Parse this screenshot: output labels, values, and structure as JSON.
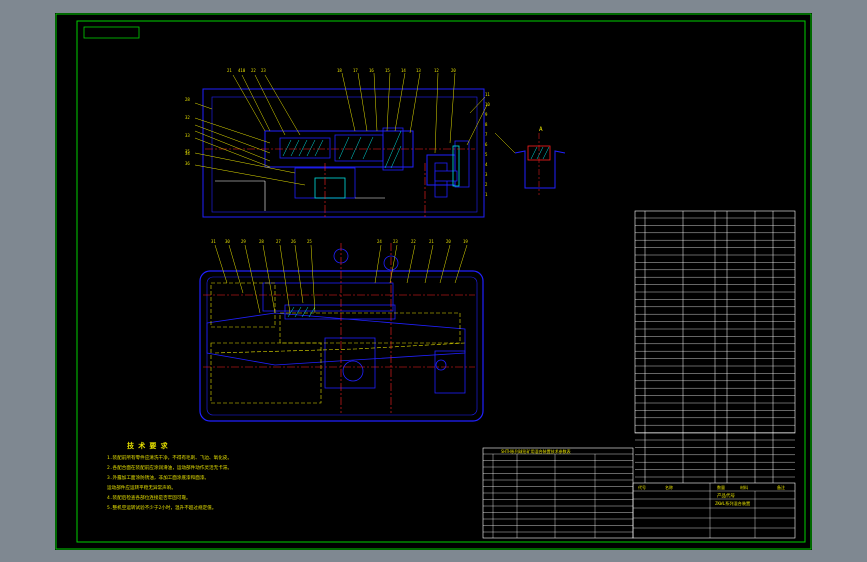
{
  "colors": {
    "background": "#7f8891",
    "sheet": "#000000",
    "frame": "#00d000",
    "outline": "#2020ff",
    "centerline": "#ff2020",
    "callout": "#e6e000",
    "hatch": "#00e0e0",
    "white_line": "#ffffff"
  },
  "top_view_labels": [
    "21",
    "410",
    "22",
    "23",
    "18",
    "17",
    "16",
    "15",
    "14",
    "13",
    "12",
    "20"
  ],
  "left_labels_upper": [
    "28",
    "32",
    "33",
    "34"
  ],
  "left_labels_lower": [
    "35",
    "36"
  ],
  "right_labels": [
    "11",
    "10",
    "9",
    "8",
    "7",
    "6",
    "5",
    "4",
    "3",
    "2",
    "1"
  ],
  "bottom_row_labels": [
    "31",
    "30",
    "29",
    "28",
    "27",
    "26",
    "25",
    "24",
    "23",
    "22",
    "21",
    "20",
    "19"
  ],
  "detail_label": "A",
  "notes": {
    "heading": "技 术 要 求",
    "lines": [
      "1.装配前所有零件应清洗干净，不得有毛刺、飞边、氧化皮。",
      "2.各配合面在装配前应涂润滑油，运动部件动作灵活无卡滞。",
      "3.外露加工面涂防锈油，非加工面涂底漆和面漆。",
      "运动部件应运转平稳无异常声响。",
      "4.装配后检查各部位连接是否牢固可靠。",
      "5.整机空运转试验不少于2小时，温升不超过规定值。"
    ]
  },
  "param_table_title": "SHTH系列球形矿用混合装置技术参数表",
  "title_block": {
    "header_cells": [
      "代号",
      "名称",
      "数量",
      "材料",
      "备注"
    ],
    "company": "产品代号",
    "drawing_name": "ZKWL系列混合装置"
  }
}
